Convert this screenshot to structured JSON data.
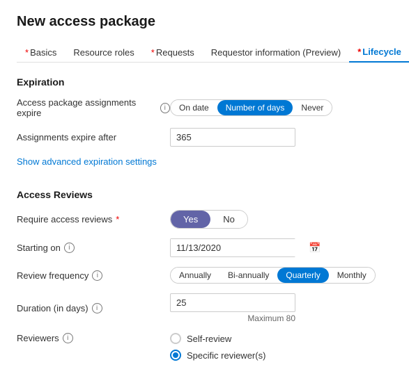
{
  "page": {
    "title": "New access package"
  },
  "nav": {
    "tabs": [
      {
        "id": "basics",
        "label": "Basics",
        "required": true,
        "active": false
      },
      {
        "id": "resource-roles",
        "label": "Resource roles",
        "required": false,
        "active": false
      },
      {
        "id": "requests",
        "label": "Requests",
        "required": true,
        "active": false
      },
      {
        "id": "requestor-info",
        "label": "Requestor information (Preview)",
        "required": false,
        "active": false
      },
      {
        "id": "lifecycle",
        "label": "Lifecycle",
        "required": true,
        "active": true
      }
    ]
  },
  "expiration": {
    "section_title": "Expiration",
    "assignments_expire_label": "Access package assignments expire",
    "toggle_options": [
      "On date",
      "Number of days",
      "Never"
    ],
    "active_toggle": "Number of days",
    "expire_after_label": "Assignments expire after",
    "expire_after_value": "365",
    "advanced_link": "Show advanced expiration settings"
  },
  "access_reviews": {
    "section_title": "Access Reviews",
    "require_label": "Require access reviews",
    "required_star": "*",
    "require_yes": "Yes",
    "require_no": "No",
    "require_active": "Yes",
    "starting_on_label": "Starting on",
    "starting_on_value": "11/13/2020",
    "frequency_label": "Review frequency",
    "frequency_options": [
      "Annually",
      "Bi-annually",
      "Quarterly",
      "Monthly"
    ],
    "frequency_active": "Quarterly",
    "duration_label": "Duration (in days)",
    "duration_value": "25",
    "duration_max": "Maximum 80",
    "reviewers_label": "Reviewers",
    "reviewer_options": [
      {
        "id": "self-review",
        "label": "Self-review",
        "selected": false
      },
      {
        "id": "specific-reviewer",
        "label": "Specific reviewer(s)",
        "selected": true
      }
    ]
  },
  "icons": {
    "info": "ℹ",
    "calendar": "📅"
  }
}
